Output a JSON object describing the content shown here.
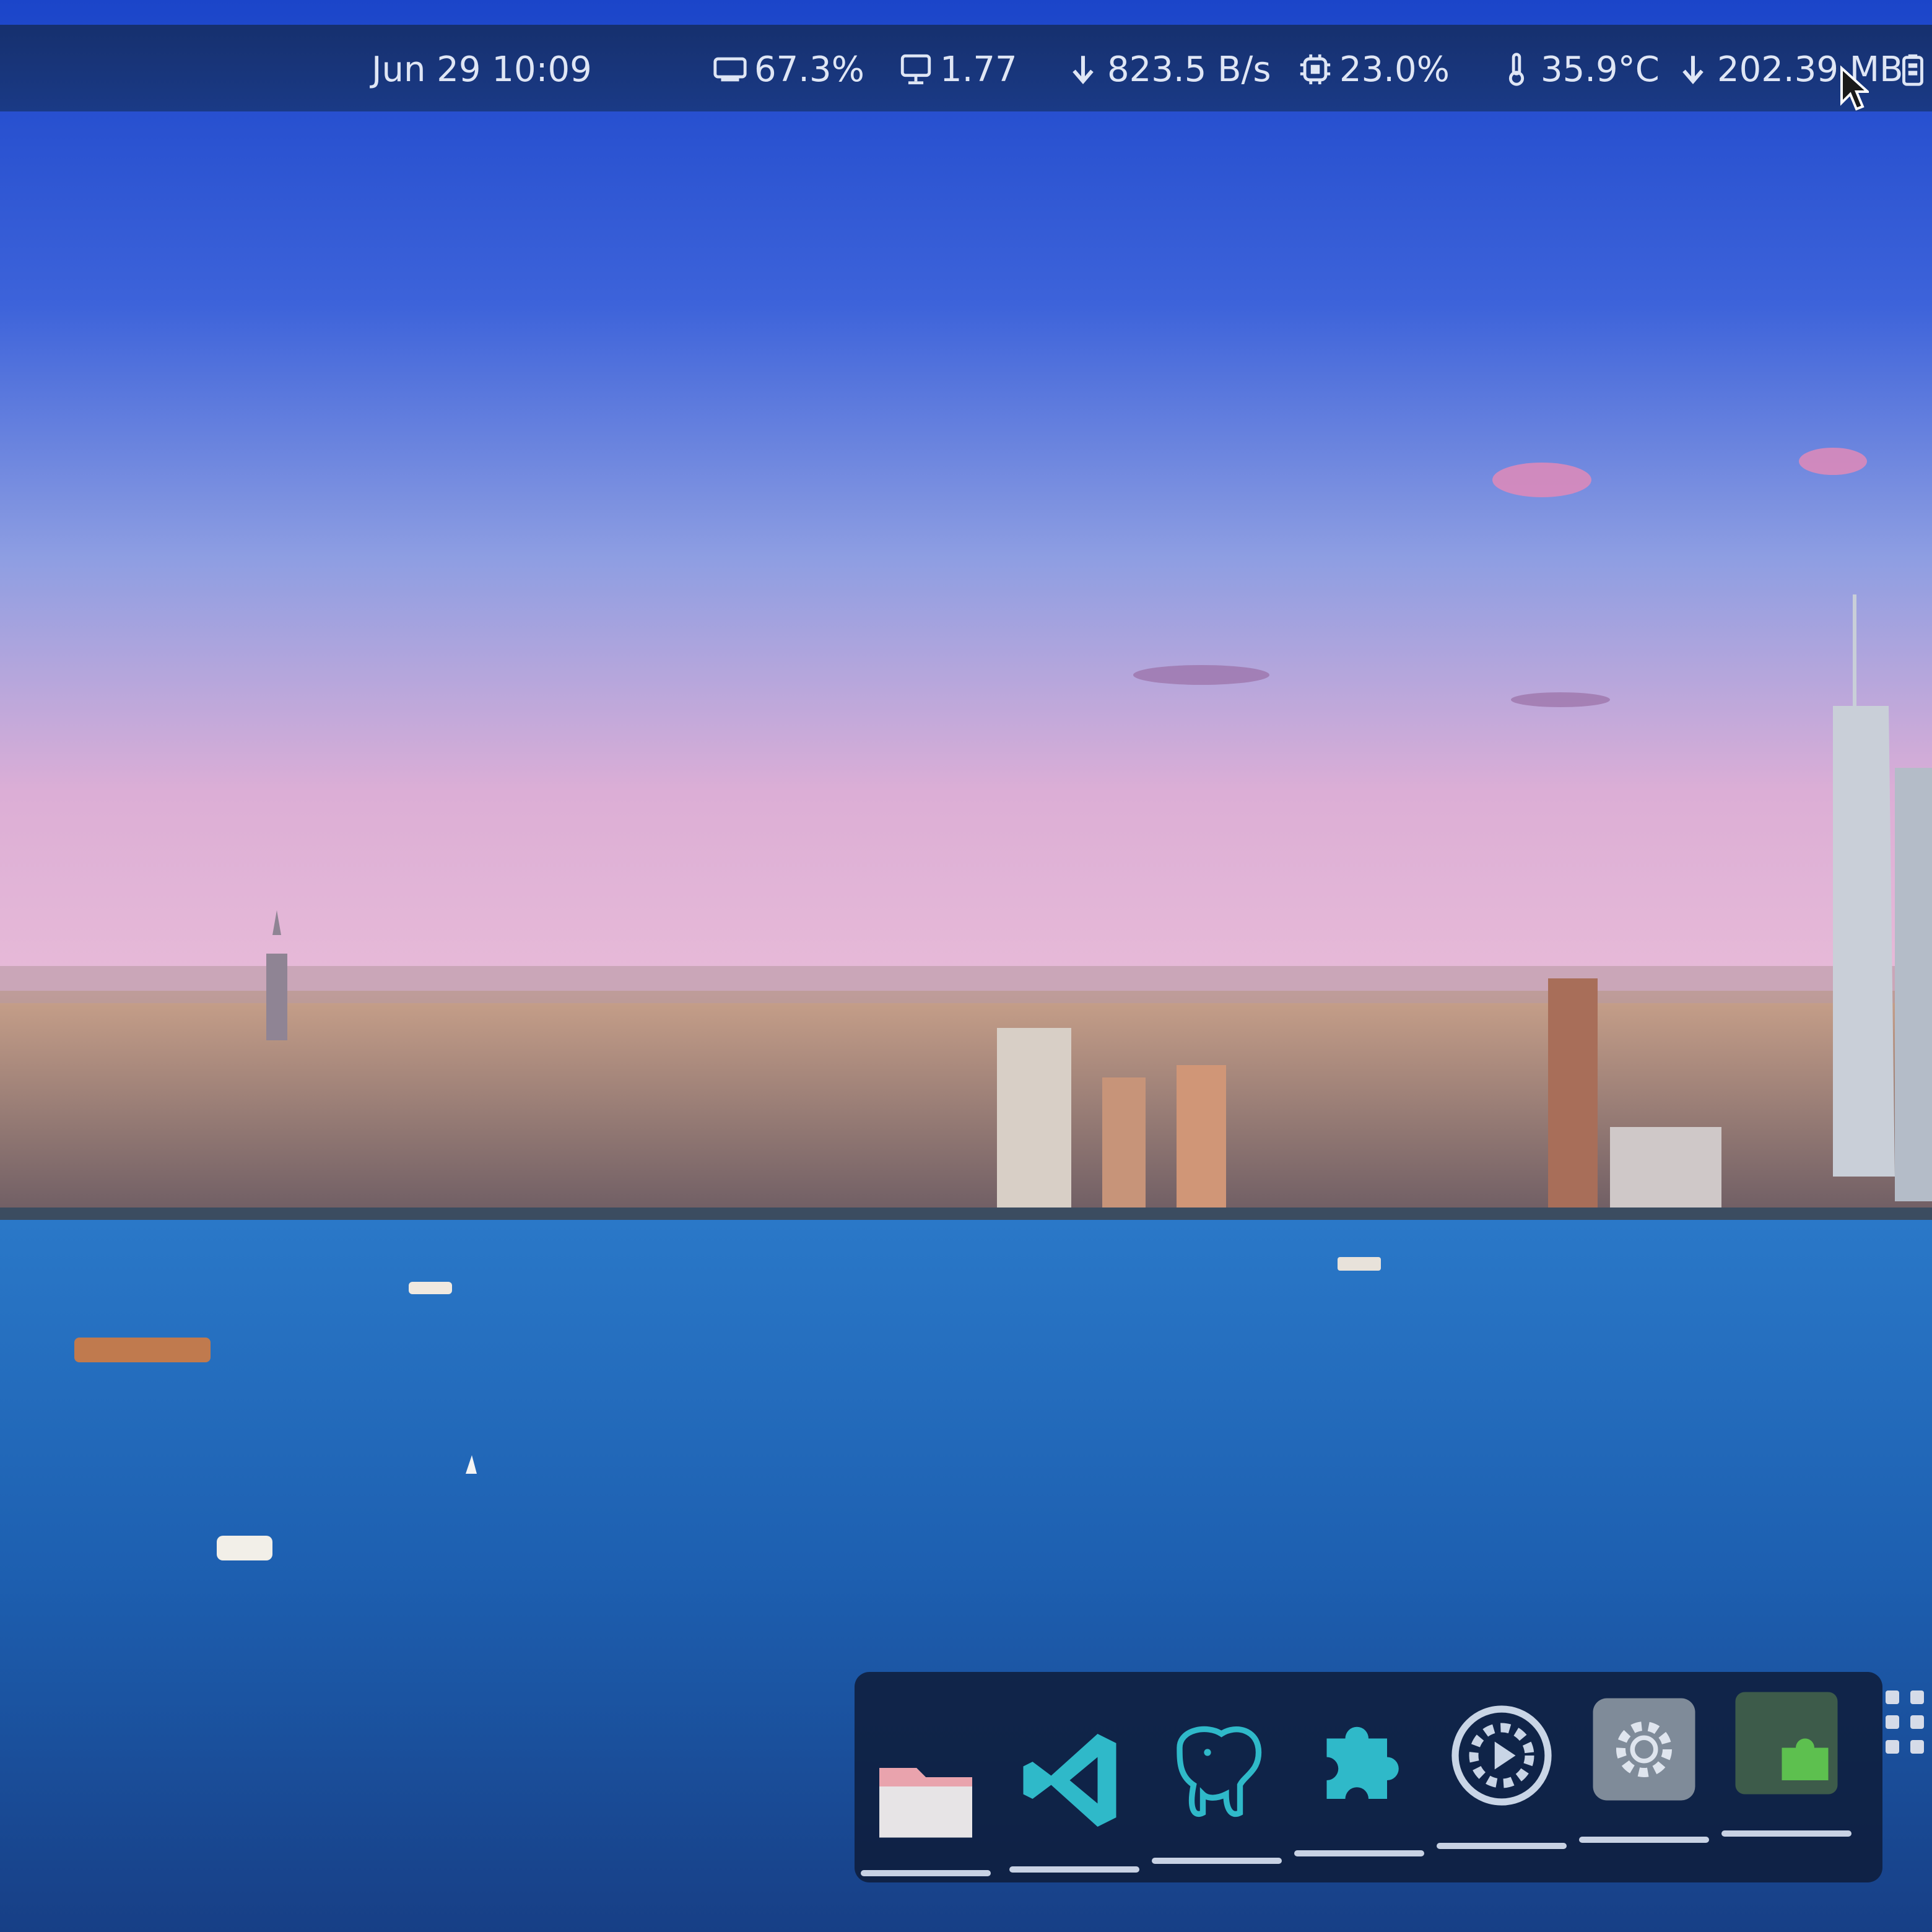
{
  "topbar": {
    "datetime": "Jun 29  10:09",
    "memory": "67.3%",
    "load": "1.77",
    "net_down": "823.5 B/s",
    "cpu": "23.0%",
    "temperature": "35.9°C",
    "disk_down": "202.39 MB"
  },
  "icons": {
    "memory": "memory-chip-icon",
    "load": "monitor-icon",
    "net": "download-arrow-icon",
    "cpu": "cpu-icon",
    "temp": "thermometer-icon",
    "disk": "download-arrow-icon",
    "battery": "battery-icon"
  },
  "dock": {
    "apps": [
      {
        "name": "Files",
        "icon": "folder-icon",
        "color": "#e9a3ad"
      },
      {
        "name": "Visual Studio Code",
        "icon": "vscode-icon",
        "color": "#2fb9c9"
      },
      {
        "name": "pgAdmin",
        "icon": "elephant-icon",
        "color": "#2fb9c9"
      },
      {
        "name": "Extensions",
        "icon": "puzzle-icon",
        "color": "#2fb9c9"
      },
      {
        "name": "Settings",
        "icon": "gear-icon",
        "color": "#c9d5e6"
      },
      {
        "name": "System Settings",
        "icon": "gear-icon",
        "color": "#b7c3d4"
      },
      {
        "name": "Extension Manager",
        "icon": "puzzle-icon",
        "color": "#5dc04f"
      }
    ],
    "app_grid_icon": "grid-icon"
  },
  "colors": {
    "topbar": "#1a3a86",
    "sky_top": "#1d4fd6",
    "sky_mid": "#5b7ee0",
    "sky_pink": "#e7b0cf",
    "water": "#1f67b4"
  }
}
